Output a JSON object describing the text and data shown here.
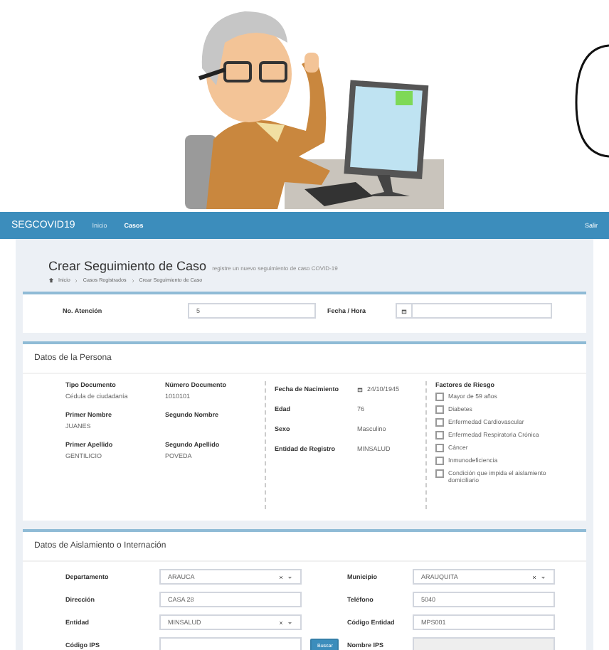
{
  "navbar": {
    "brand": "SEGCOVID19",
    "links": [
      {
        "label": "Inicio",
        "selected": false
      },
      {
        "label": "Casos",
        "selected": true
      }
    ],
    "logout": "Salir"
  },
  "header": {
    "title": "Crear Seguimiento de Caso",
    "subtitle": "registre un nuevo seguimiento de caso COVID-19",
    "breadcrumb": [
      "Inicio",
      "Casos Registrados",
      "Crear Seguimiento de Caso"
    ]
  },
  "attention": {
    "fields": [
      {
        "label": "No. Atención",
        "value": "5",
        "kind": "text"
      },
      {
        "label": "Fecha / Hora",
        "kind": "date"
      }
    ]
  },
  "person": {
    "title": "Datos de la Persona",
    "fields": [
      {
        "label": "Tipo Documento",
        "value": "Cédula de ciudadanía"
      },
      {
        "label": "Número Documento",
        "value": "1010101"
      },
      {
        "label": "Primer Nombre",
        "value": "JUANES"
      },
      {
        "label": "Segundo Nombre"
      },
      {
        "label": "Primer Apellido",
        "value": "GENTILICIO"
      },
      {
        "label": "Segundo Apellido",
        "value": "POVEDA"
      }
    ],
    "details": [
      {
        "label": "Fecha de Nacimiento",
        "value": "24/10/1945",
        "kind": "date"
      },
      {
        "label": "Edad",
        "value": "76",
        "kind": "text"
      },
      {
        "label": "Sexo",
        "value": "Masculino",
        "kind": "text"
      },
      {
        "label": "Entidad de Registro",
        "value": "MINSALUD",
        "kind": "text"
      }
    ],
    "risk": {
      "title": "Factores de Riesgo",
      "items": [
        {
          "label": "Mayor de 59 años",
          "checked": false
        },
        {
          "label": "Diabetes",
          "checked": false
        },
        {
          "label": "Enfermedad Cardiovascular",
          "checked": false
        },
        {
          "label": "Enfermedad Respiratoria Crónica",
          "checked": false
        },
        {
          "label": "Cáncer",
          "checked": false
        },
        {
          "label": "Inmunodeficiencia",
          "checked": false
        },
        {
          "label": "Condición que impida el aislamiento domiciliario",
          "checked": false
        }
      ]
    }
  },
  "isolation": {
    "title": "Datos de Aislamiento o Internación",
    "fields": [
      {
        "label": "Departamento",
        "value": "ARAUCA",
        "kind": "select"
      },
      {
        "label": "Municipio",
        "value": "ARAUQUITA",
        "kind": "select"
      },
      {
        "label": "Dirección",
        "value": "CASA 28",
        "kind": "text"
      },
      {
        "label": "Teléfono",
        "value": "5040",
        "kind": "text"
      },
      {
        "label": "Entidad",
        "value": "MINSALUD",
        "kind": "select"
      },
      {
        "label": "Código Entidad",
        "value": "MPS001",
        "kind": "text"
      },
      {
        "label": "Código IPS",
        "kind": "search",
        "button": "Buscar"
      },
      {
        "label": "Nombre IPS",
        "kind": "readonly"
      }
    ]
  }
}
